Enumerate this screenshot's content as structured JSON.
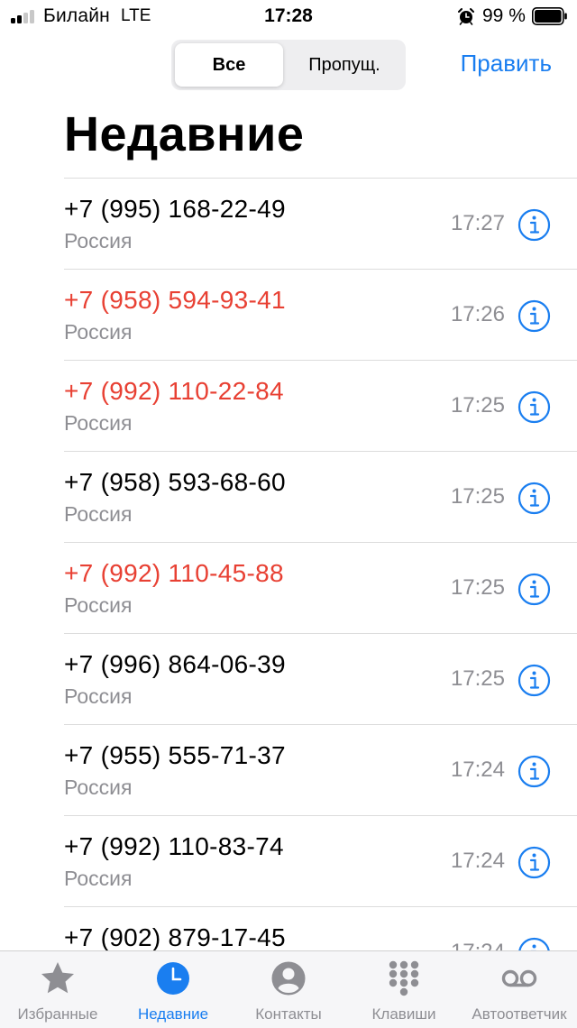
{
  "status_bar": {
    "carrier": "Билайн",
    "network": "LTE",
    "time": "17:28",
    "battery": "99 %"
  },
  "segment": {
    "all_label": "Все",
    "missed_label": "Пропущ.",
    "selected": "all"
  },
  "edit_label": "Править",
  "title": "Недавние",
  "colors": {
    "accent": "#1a7ef0",
    "missed": "#e84033",
    "secondary_text": "#8e8e93"
  },
  "calls": [
    {
      "number": "+7 (995) 168-22-49",
      "location": "Россия",
      "time": "17:27",
      "missed": false
    },
    {
      "number": "+7 (958) 594-93-41",
      "location": "Россия",
      "time": "17:26",
      "missed": true
    },
    {
      "number": "+7 (992) 110-22-84",
      "location": "Россия",
      "time": "17:25",
      "missed": true
    },
    {
      "number": "+7 (958) 593-68-60",
      "location": "Россия",
      "time": "17:25",
      "missed": false
    },
    {
      "number": "+7 (992) 110-45-88",
      "location": "Россия",
      "time": "17:25",
      "missed": true
    },
    {
      "number": "+7 (996) 864-06-39",
      "location": "Россия",
      "time": "17:25",
      "missed": false
    },
    {
      "number": "+7 (955) 555-71-37",
      "location": "Россия",
      "time": "17:24",
      "missed": false
    },
    {
      "number": "+7 (992) 110-83-74",
      "location": "Россия",
      "time": "17:24",
      "missed": false
    },
    {
      "number": "+7 (902) 879-17-45",
      "location": "",
      "time": "17:24",
      "missed": false
    }
  ],
  "tabs": [
    {
      "label": "Избранные",
      "icon": "star-icon",
      "active": false
    },
    {
      "label": "Недавние",
      "icon": "clock-icon",
      "active": true
    },
    {
      "label": "Контакты",
      "icon": "person-icon",
      "active": false
    },
    {
      "label": "Клавиши",
      "icon": "keypad-icon",
      "active": false
    },
    {
      "label": "Автоответчик",
      "icon": "voicemail-icon",
      "active": false
    }
  ]
}
